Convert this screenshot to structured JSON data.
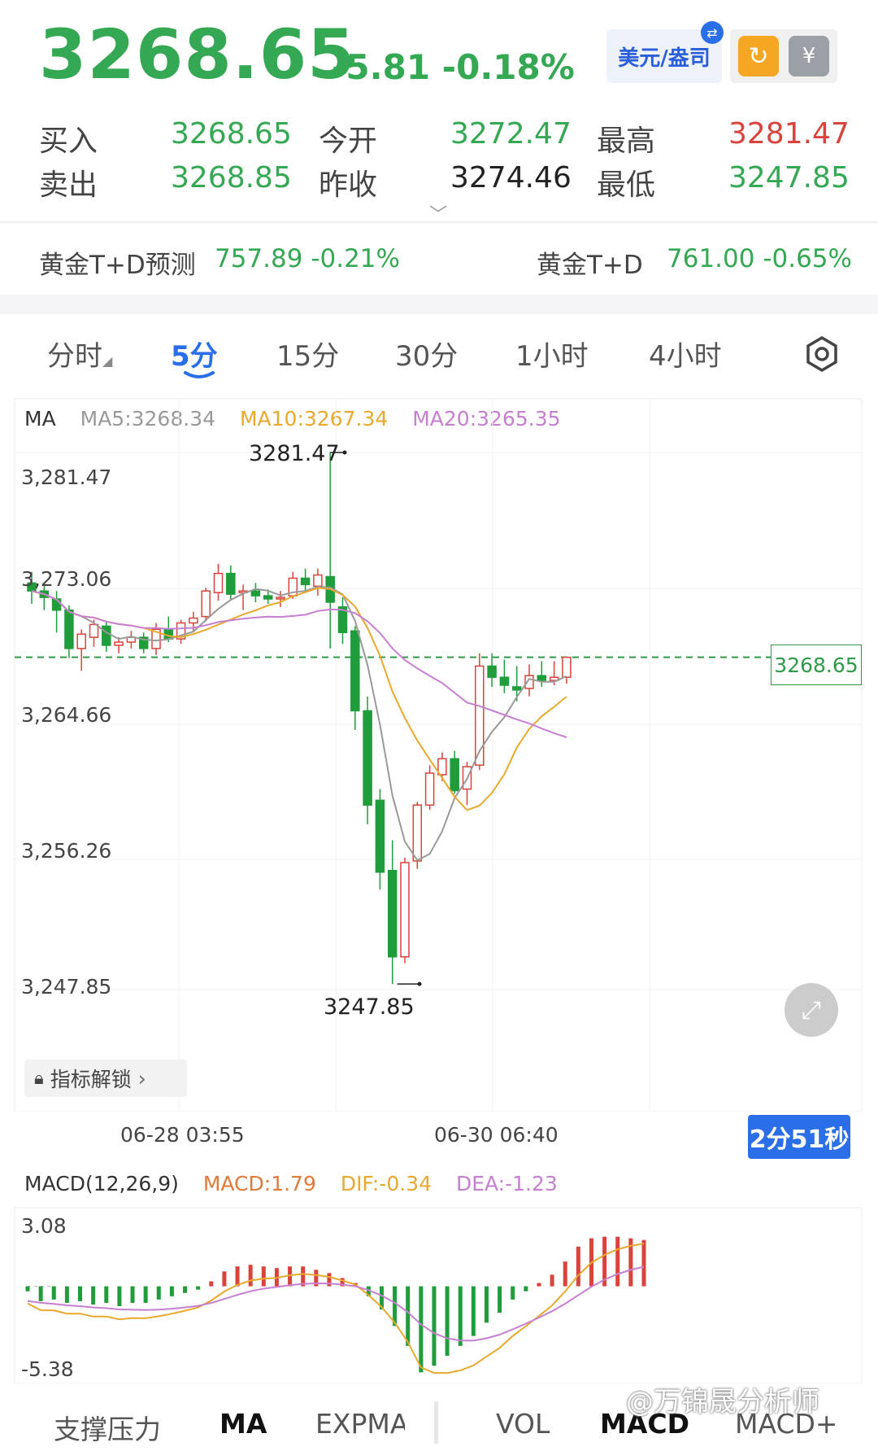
{
  "header": {
    "price": "3268.65",
    "change": "-5.81 -0.18%",
    "currency_button": "美元/盎司"
  },
  "quotes": {
    "buy_label": "买入",
    "buy_value": "3268.65",
    "sell_label": "卖出",
    "sell_value": "3268.85",
    "open_label": "今开",
    "open_value": "3272.47",
    "prev_close_label": "昨收",
    "prev_close_value": "3274.46",
    "high_label": "最高",
    "high_value": "3281.47",
    "low_label": "最低",
    "low_value": "3247.85"
  },
  "related": {
    "left_label": "黄金T+D预测",
    "left_value": "757.89 -0.21%",
    "right_label": "黄金T+D",
    "right_value": "761.00 -0.65%"
  },
  "period_tabs": [
    "分时",
    "5分",
    "15分",
    "30分",
    "1小时",
    "4小时"
  ],
  "active_tab": "5分",
  "ma_legend": {
    "title": "MA",
    "ma5": "MA5:3268.34",
    "ma10": "MA10:3267.34",
    "ma20": "MA20:3265.35"
  },
  "colors": {
    "up": "#d9433b",
    "down": "#1f9d3a",
    "ma5": "#999999",
    "ma10": "#e8a92e",
    "ma20": "#c77fd1",
    "accent": "#2b6fe8"
  },
  "chart_data": [
    {
      "type": "candlestick",
      "y_ticks": [
        "3,281.47",
        "3,273.06",
        "3,264.66",
        "3,256.26",
        "3,247.85"
      ],
      "ylim": [
        3247.85,
        3281.47
      ],
      "x_ticks": [
        "06-28 03:55",
        "06-30 06:40"
      ],
      "current_price_label": "3268.65",
      "max_label": "3281.47",
      "min_label": "3247.85",
      "candles": [
        [
          3273.3,
          3274.0,
          3272.0,
          3272.8
        ],
        [
          3272.8,
          3273.2,
          3271.6,
          3272.4
        ],
        [
          3272.3,
          3272.8,
          3270.2,
          3271.6
        ],
        [
          3271.6,
          3271.9,
          3268.6,
          3269.2
        ],
        [
          3269.2,
          3270.4,
          3267.8,
          3270.1
        ],
        [
          3269.9,
          3271.0,
          3269.3,
          3270.7
        ],
        [
          3270.6,
          3270.9,
          3269.0,
          3269.4
        ],
        [
          3269.4,
          3269.9,
          3268.9,
          3269.6
        ],
        [
          3269.6,
          3270.3,
          3269.2,
          3269.9
        ],
        [
          3269.9,
          3270.2,
          3268.9,
          3269.2
        ],
        [
          3269.2,
          3270.8,
          3268.8,
          3270.4
        ],
        [
          3270.4,
          3271.2,
          3269.6,
          3269.8
        ],
        [
          3269.8,
          3271.0,
          3269.5,
          3270.8
        ],
        [
          3270.8,
          3271.5,
          3270.2,
          3271.1
        ],
        [
          3271.2,
          3273.0,
          3270.9,
          3272.8
        ],
        [
          3272.7,
          3274.5,
          3272.2,
          3273.9
        ],
        [
          3273.9,
          3274.4,
          3272.2,
          3272.6
        ],
        [
          3272.7,
          3273.2,
          3271.6,
          3272.8
        ],
        [
          3272.8,
          3273.3,
          3272.1,
          3272.5
        ],
        [
          3272.5,
          3272.9,
          3272.0,
          3272.3
        ],
        [
          3272.3,
          3272.8,
          3271.8,
          3272.4
        ],
        [
          3272.5,
          3274.0,
          3272.3,
          3273.6
        ],
        [
          3273.6,
          3274.2,
          3272.8,
          3273.2
        ],
        [
          3273.1,
          3274.2,
          3272.5,
          3273.8
        ],
        [
          3273.7,
          3281.47,
          3269.2,
          3272.1
        ],
        [
          3271.8,
          3272.4,
          3269.5,
          3270.2
        ],
        [
          3270.3,
          3270.6,
          3264.1,
          3265.3
        ],
        [
          3265.3,
          3266.2,
          3258.2,
          3259.4
        ],
        [
          3259.7,
          3260.4,
          3254.1,
          3255.2
        ],
        [
          3255.3,
          3257.2,
          3248.2,
          3249.9
        ],
        [
          3249.9,
          3256.1,
          3249.5,
          3255.8
        ],
        [
          3255.9,
          3259.6,
          3255.4,
          3259.4
        ],
        [
          3259.4,
          3261.9,
          3259.1,
          3261.4
        ],
        [
          3261.3,
          3262.7,
          3260.9,
          3262.3
        ],
        [
          3262.3,
          3262.8,
          3260.1,
          3260.3
        ],
        [
          3260.4,
          3262.1,
          3259.4,
          3261.8
        ],
        [
          3261.9,
          3268.9,
          3261.6,
          3268.1
        ],
        [
          3268.1,
          3268.9,
          3266.8,
          3267.4
        ],
        [
          3267.4,
          3268.5,
          3266.4,
          3266.9
        ],
        [
          3266.8,
          3268.1,
          3265.9,
          3266.6
        ],
        [
          3266.7,
          3268.2,
          3266.2,
          3267.5
        ],
        [
          3267.5,
          3268.4,
          3266.8,
          3267.2
        ],
        [
          3267.2,
          3268.4,
          3266.9,
          3267.4
        ],
        [
          3267.4,
          3268.5,
          3267.0,
          3268.65
        ]
      ]
    },
    {
      "type": "bar",
      "title": "MACD(12,26,9)",
      "legend": [
        "MACD:1.79",
        "DIF:-0.34",
        "DEA:-1.23"
      ],
      "y_ticks": [
        "3.08",
        "-5.38"
      ],
      "ylim": [
        -5.38,
        3.08
      ],
      "values": [
        -0.3,
        -0.9,
        -0.8,
        -1.0,
        -0.9,
        -1.1,
        -1.0,
        -1.2,
        -1.0,
        -1.0,
        -0.8,
        -0.6,
        -0.4,
        -0.2,
        0.3,
        0.9,
        1.2,
        1.3,
        1.2,
        1.1,
        1.2,
        1.2,
        1.0,
        0.8,
        0.5,
        0.2,
        -0.6,
        -1.4,
        -2.4,
        -3.6,
        -5.2,
        -4.8,
        -4.2,
        -3.6,
        -3.0,
        -2.2,
        -1.6,
        -0.8,
        -0.3,
        0.2,
        0.7,
        1.5,
        2.4,
        2.9,
        3.0,
        3.0,
        2.9,
        2.8
      ]
    }
  ],
  "indicator_unlock": "指标解锁",
  "countdown": "2分51秒",
  "bottom_tabs": [
    "支撑压力",
    "MA",
    "EXPMA",
    "VOL",
    "MACD",
    "MACD+"
  ],
  "watermark": "@万锦晟分析师"
}
